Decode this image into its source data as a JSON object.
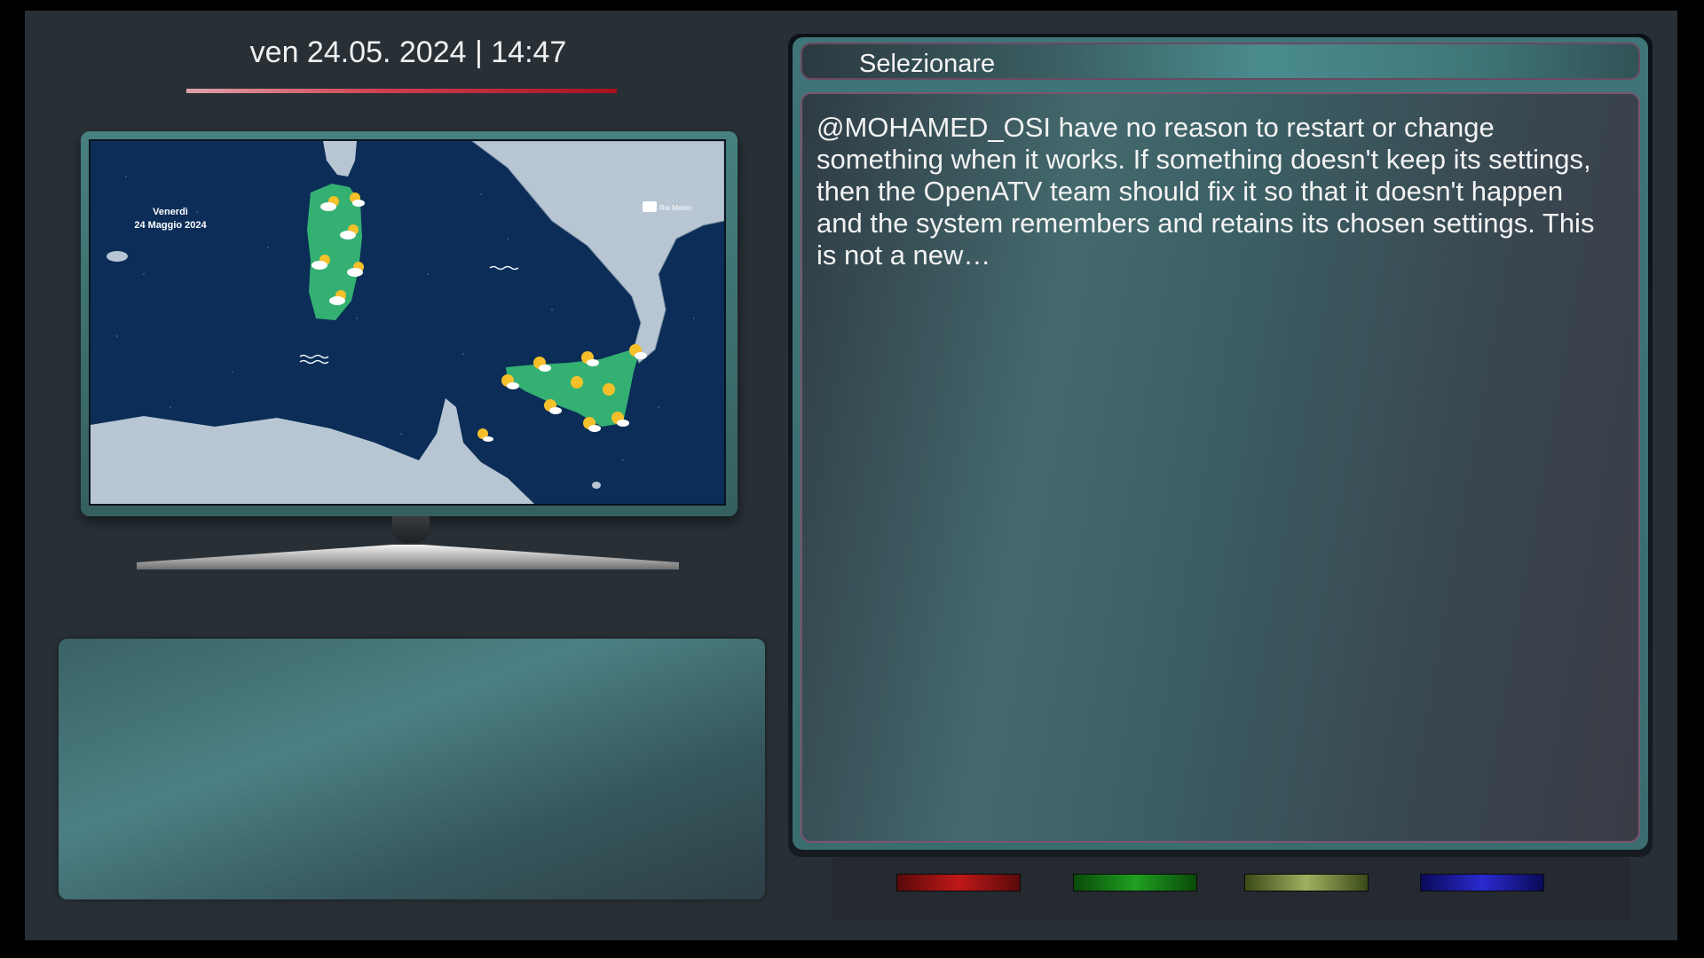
{
  "clock": {
    "datetime": "ven 24.05. 2024 | 14:47"
  },
  "tv": {
    "channel_logo": "Rai Meteo",
    "weather_map": {
      "day": "Venerdì",
      "date": "24 Maggio 2024",
      "icon": "sun-cloud-icon"
    }
  },
  "panel": {
    "title": "Selezionare",
    "message": "@MOHAMED_OSI have no reason to restart or change something when it works. If something doesn't keep its settings, then the OpenATV team should fix it so that it doesn't happen and the system remembers and retains its chosen settings. This is not a new…"
  },
  "color_keys": [
    {
      "name": "red-key",
      "color": "#c01818"
    },
    {
      "name": "green-key",
      "color": "#20a020"
    },
    {
      "name": "yellow-key",
      "color": "#a0b060"
    },
    {
      "name": "blue-key",
      "color": "#2a2ad0"
    }
  ]
}
